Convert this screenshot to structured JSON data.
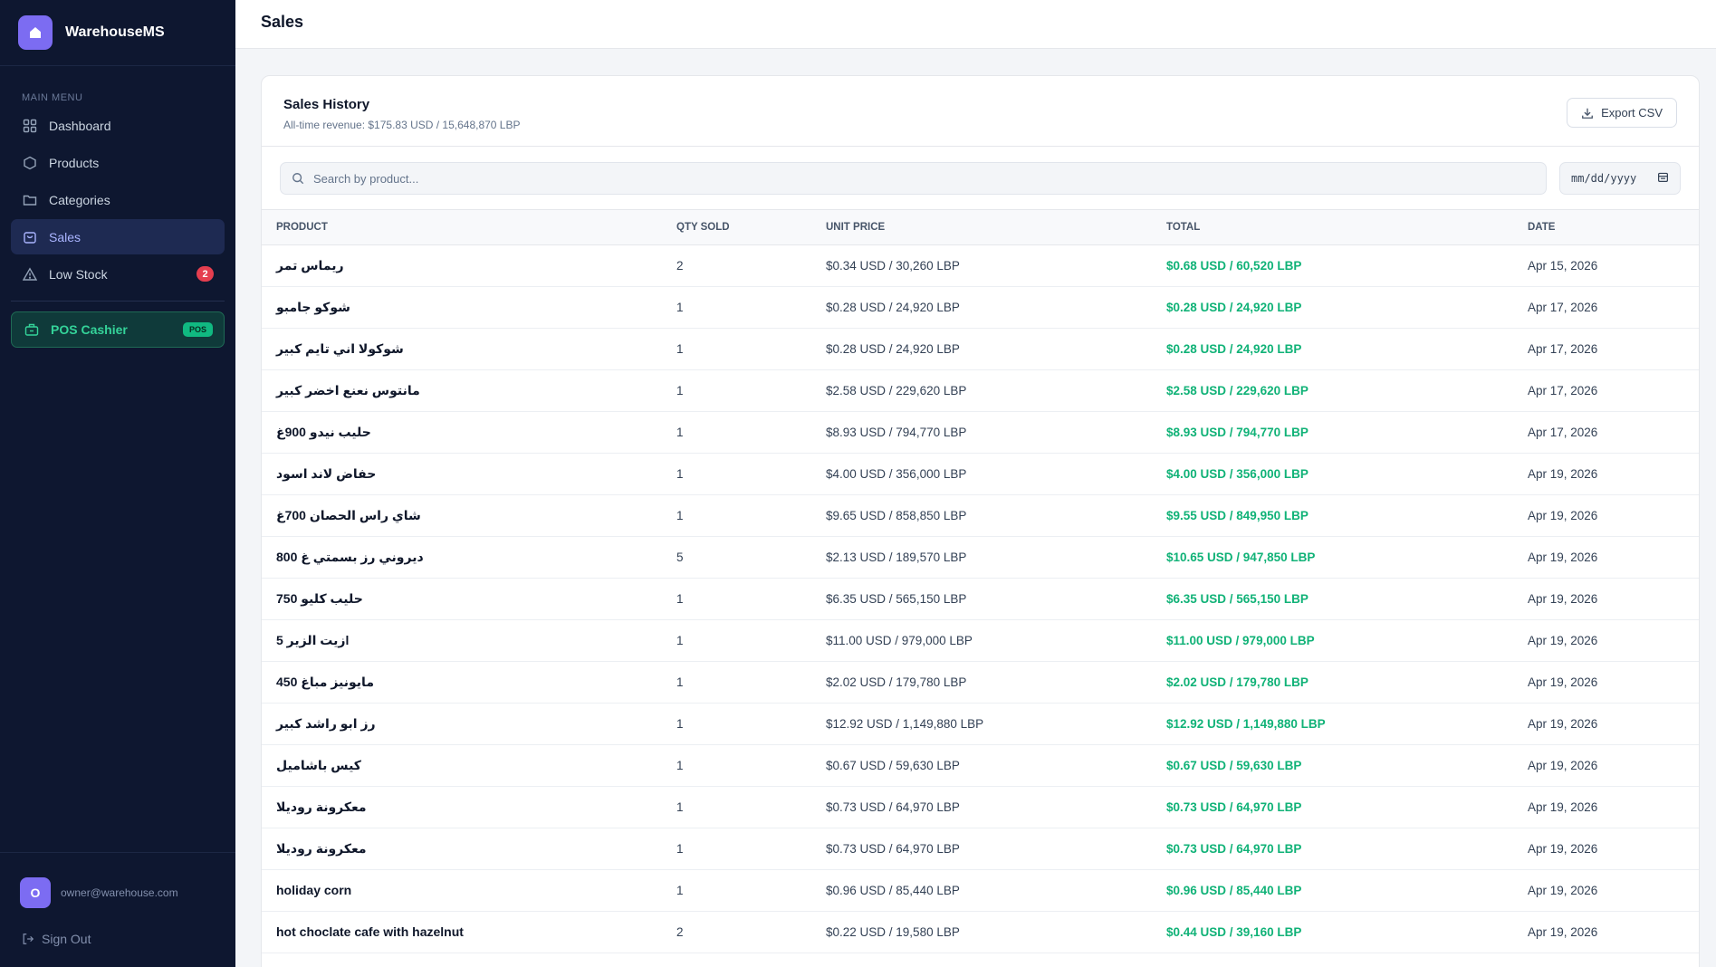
{
  "app": {
    "name": "WarehouseMS"
  },
  "sidebar": {
    "menu_label": "MAIN MENU",
    "items": [
      {
        "label": "Dashboard",
        "icon": "grid-icon"
      },
      {
        "label": "Products",
        "icon": "box-icon"
      },
      {
        "label": "Categories",
        "icon": "folder-icon"
      },
      {
        "label": "Sales",
        "icon": "shopping-bag-icon",
        "active": true
      },
      {
        "label": "Low Stock",
        "icon": "warning-icon",
        "badge": "2"
      }
    ],
    "pos": {
      "label": "POS Cashier",
      "tag": "POS"
    },
    "user": {
      "initial": "O",
      "email": "owner@warehouse.com"
    },
    "sign_out": "Sign Out"
  },
  "header": {
    "title": "Sales"
  },
  "sales": {
    "title": "Sales History",
    "subtitle": "All-time revenue: $175.83 USD / 15,648,870 LBP",
    "export_label": "Export CSV",
    "search_placeholder": "Search by product...",
    "date_placeholder": "mm/dd/yyyy",
    "columns": [
      "PRODUCT",
      "QTY SOLD",
      "UNIT PRICE",
      "TOTAL",
      "DATE"
    ],
    "rows": [
      {
        "product": "ريماس تمر",
        "qty": "2",
        "unit": "$0.34 USD / 30,260 LBP",
        "total": "$0.68 USD / 60,520 LBP",
        "date": "Apr 15, 2026"
      },
      {
        "product": "شوكو جامبو",
        "qty": "1",
        "unit": "$0.28 USD / 24,920 LBP",
        "total": "$0.28 USD / 24,920 LBP",
        "date": "Apr 17, 2026"
      },
      {
        "product": "شوكولا اني تايم كبير",
        "qty": "1",
        "unit": "$0.28 USD / 24,920 LBP",
        "total": "$0.28 USD / 24,920 LBP",
        "date": "Apr 17, 2026"
      },
      {
        "product": "مانتوس نعنع اخضر كبير",
        "qty": "1",
        "unit": "$2.58 USD / 229,620 LBP",
        "total": "$2.58 USD / 229,620 LBP",
        "date": "Apr 17, 2026"
      },
      {
        "product": "حليب نيدو 900غ",
        "qty": "1",
        "unit": "$8.93 USD / 794,770 LBP",
        "total": "$8.93 USD / 794,770 LBP",
        "date": "Apr 17, 2026"
      },
      {
        "product": "حفاض لاند اسود",
        "qty": "1",
        "unit": "$4.00 USD / 356,000 LBP",
        "total": "$4.00 USD / 356,000 LBP",
        "date": "Apr 19, 2026"
      },
      {
        "product": "شاي راس الحصان 700غ",
        "qty": "1",
        "unit": "$9.65 USD / 858,850 LBP",
        "total": "$9.55 USD / 849,950 LBP",
        "date": "Apr 19, 2026"
      },
      {
        "product": "ديروني رز بسمتي غ 800",
        "qty": "5",
        "unit": "$2.13 USD / 189,570 LBP",
        "total": "$10.65 USD / 947,850 LBP",
        "date": "Apr 19, 2026"
      },
      {
        "product": "حليب كليو 750",
        "qty": "1",
        "unit": "$6.35 USD / 565,150 LBP",
        "total": "$6.35 USD / 565,150 LBP",
        "date": "Apr 19, 2026"
      },
      {
        "product": "زيت الزير 5l",
        "qty": "1",
        "unit": "$11.00 USD / 979,000 LBP",
        "total": "$11.00 USD / 979,000 LBP",
        "date": "Apr 19, 2026"
      },
      {
        "product": "مايونيز مباغ 450",
        "qty": "1",
        "unit": "$2.02 USD / 179,780 LBP",
        "total": "$2.02 USD / 179,780 LBP",
        "date": "Apr 19, 2026"
      },
      {
        "product": "رز ابو راشد كبير",
        "qty": "1",
        "unit": "$12.92 USD / 1,149,880 LBP",
        "total": "$12.92 USD / 1,149,880 LBP",
        "date": "Apr 19, 2026"
      },
      {
        "product": "كيس باشاميل",
        "qty": "1",
        "unit": "$0.67 USD / 59,630 LBP",
        "total": "$0.67 USD / 59,630 LBP",
        "date": "Apr 19, 2026"
      },
      {
        "product": "معكرونة روديلا",
        "qty": "1",
        "unit": "$0.73 USD / 64,970 LBP",
        "total": "$0.73 USD / 64,970 LBP",
        "date": "Apr 19, 2026"
      },
      {
        "product": "معكرونة روديلا",
        "qty": "1",
        "unit": "$0.73 USD / 64,970 LBP",
        "total": "$0.73 USD / 64,970 LBP",
        "date": "Apr 19, 2026"
      },
      {
        "product": "holiday corn",
        "qty": "1",
        "unit": "$0.96 USD / 85,440 LBP",
        "total": "$0.96 USD / 85,440 LBP",
        "date": "Apr 19, 2026"
      },
      {
        "product": "hot choclate cafe with hazelnut",
        "qty": "2",
        "unit": "$0.22 USD / 19,580 LBP",
        "total": "$0.44 USD / 39,160 LBP",
        "date": "Apr 19, 2026"
      }
    ]
  },
  "colors": {
    "accent": "#7c6cf2",
    "sidebar_bg": "#0e1730",
    "total_green": "#10b277",
    "pos_green": "#34d399",
    "badge_red": "#e53e4f"
  }
}
